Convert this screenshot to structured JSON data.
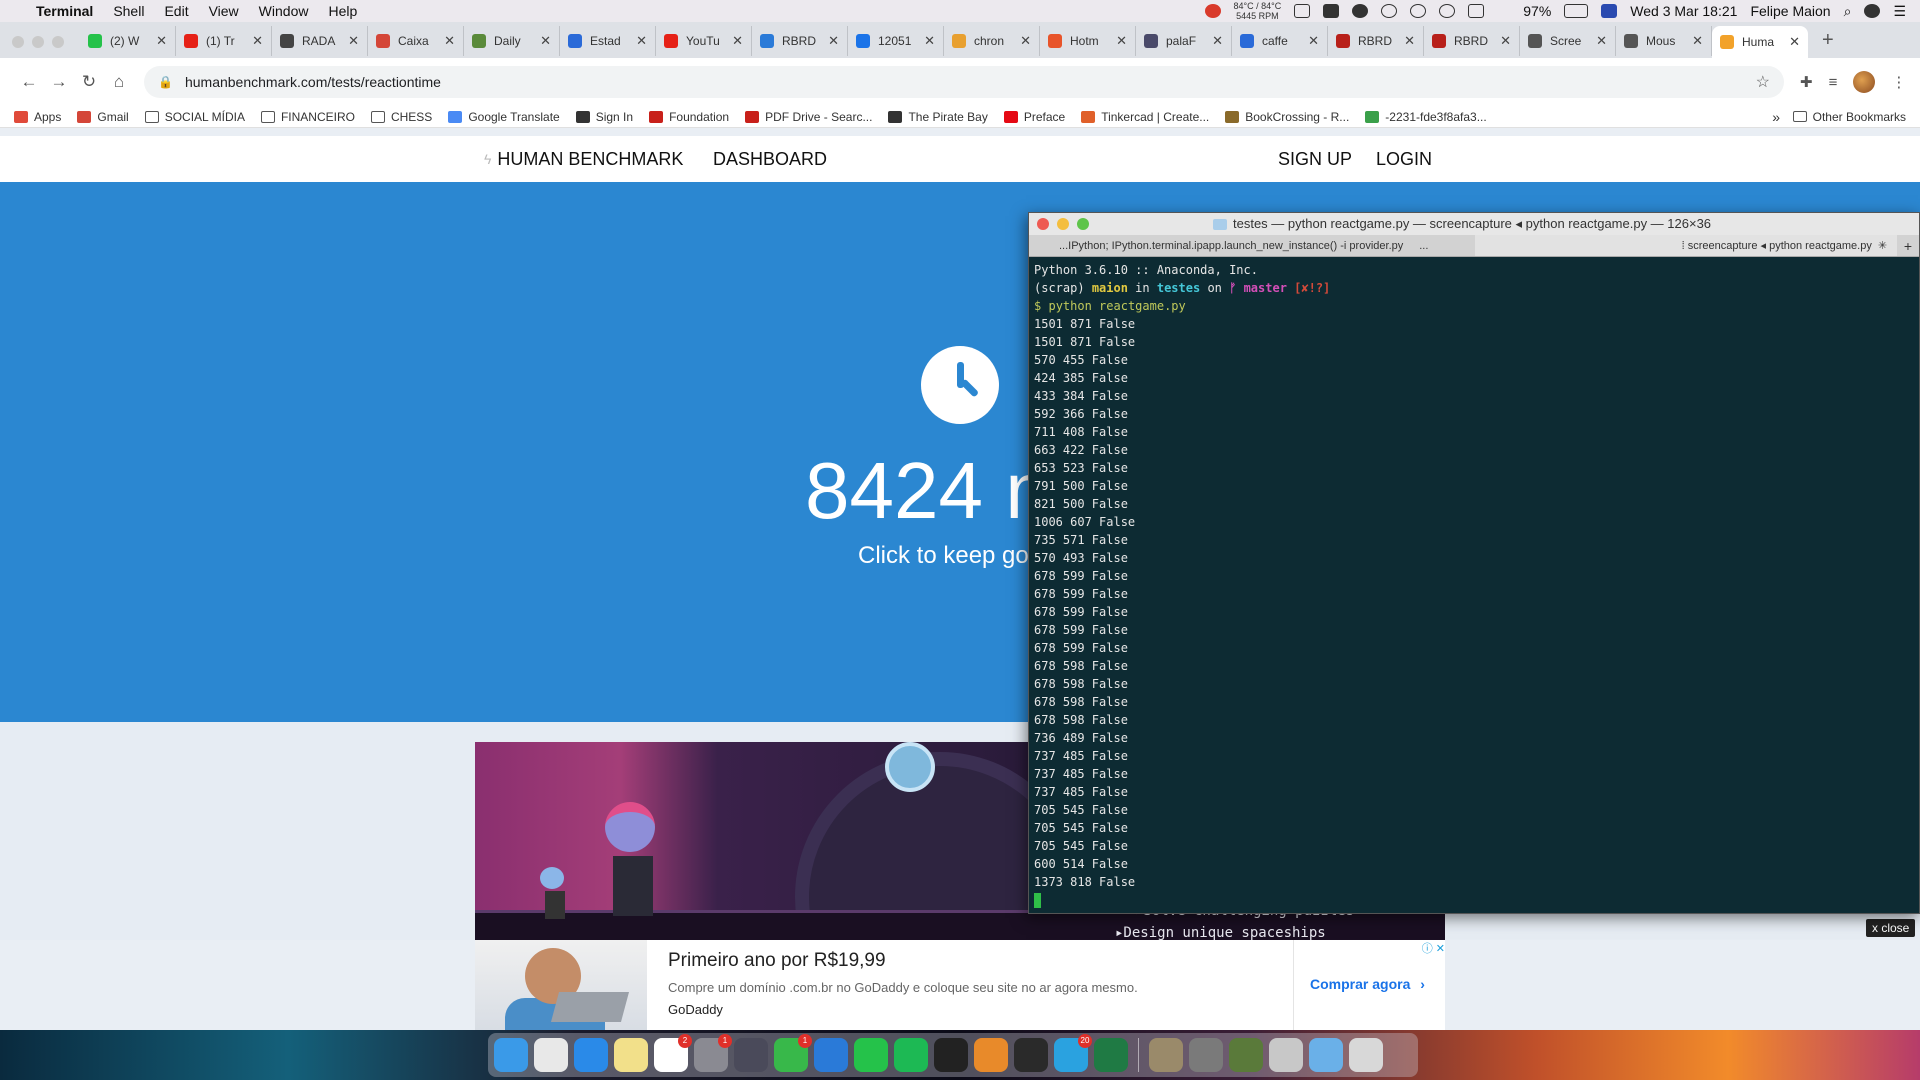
{
  "menubar": {
    "app_name": "Terminal",
    "menus": [
      "Shell",
      "Edit",
      "View",
      "Window",
      "Help"
    ],
    "temp_line1": "84°C / 84°C",
    "temp_line2": "5445 RPM",
    "battery": "97%",
    "datetime": "Wed 3 Mar  18:21",
    "user": "Felipe Maion"
  },
  "browser": {
    "tabs": [
      {
        "label": "(2) W",
        "color": "#25c24a"
      },
      {
        "label": "(1) Tr",
        "color": "#e62117"
      },
      {
        "label": "RADA",
        "color": "#444444"
      },
      {
        "label": "Caixa",
        "color": "#d44638"
      },
      {
        "label": "Daily",
        "color": "#5a8a3a"
      },
      {
        "label": "Estad",
        "color": "#2a6ad8"
      },
      {
        "label": "YouTu",
        "color": "#e62117"
      },
      {
        "label": "RBRD",
        "color": "#2a7ad8"
      },
      {
        "label": "12051",
        "color": "#1a73e8"
      },
      {
        "label": "chron",
        "color": "#e8a030"
      },
      {
        "label": "Hotm",
        "color": "#e8542a"
      },
      {
        "label": "palaF",
        "color": "#4a4a6a"
      },
      {
        "label": "caffe",
        "color": "#2a6ad8"
      },
      {
        "label": "RBRD",
        "color": "#b8201a"
      },
      {
        "label": "RBRD",
        "color": "#b8201a"
      },
      {
        "label": "Scree",
        "color": "#555555"
      },
      {
        "label": "Mous",
        "color": "#555555"
      },
      {
        "label": "Huma",
        "color": "#f2a22a"
      }
    ],
    "url": "humanbenchmark.com/tests/reactiontime",
    "bookmarks": [
      {
        "label": "Apps",
        "kind": "apps"
      },
      {
        "label": "Gmail",
        "kind": "gmail"
      },
      {
        "label": "SOCIAL MÍDIA",
        "kind": "folder"
      },
      {
        "label": "FINANCEIRO",
        "kind": "folder"
      },
      {
        "label": "CHESS",
        "kind": "folder"
      },
      {
        "label": "Google Translate",
        "kind": "translate"
      },
      {
        "label": "Sign In",
        "kind": "github"
      },
      {
        "label": "Foundation",
        "kind": "pg"
      },
      {
        "label": "PDF Drive - Searc...",
        "kind": "pdf"
      },
      {
        "label": "The Pirate Bay",
        "kind": "pirate"
      },
      {
        "label": "Preface",
        "kind": "netflix"
      },
      {
        "label": "Tinkercad | Create...",
        "kind": "tinkercad"
      },
      {
        "label": "BookCrossing - R...",
        "kind": "book"
      },
      {
        "label": "-2231-fde3f8afa3...",
        "kind": "drive"
      }
    ],
    "more_bookmarks": "»",
    "other_bookmarks": "Other Bookmarks"
  },
  "site": {
    "brand": "HUMAN BENCHMARK",
    "dashboard": "DASHBOARD",
    "signup": "SIGN UP",
    "login": "LOGIN",
    "score": "8424 ms",
    "subtitle": "Click to keep going"
  },
  "game_ad": {
    "features": [
      "▸Solve challenging puzzles",
      "▸Design unique spaceships"
    ]
  },
  "ad": {
    "headline": "Primeiro ano por R$19,99",
    "description": "Compre um domínio .com.br no GoDaddy e coloque seu site no ar agora mesmo.",
    "advertiser": "GoDaddy",
    "cta": "Comprar agora",
    "cta_arrow": "›",
    "close": "x close"
  },
  "terminal": {
    "title": "testes — python reactgame.py — screencapture ◂ python reactgame.py — 126×36",
    "tab1": "...IPython; IPython.terminal.ipapp.launch_new_instance() -i provider.py",
    "tab1_more": "...",
    "tab2": "⁞ screencapture ◂ python reactgame.py",
    "header_line": "Python 3.6.10 :: Anaconda, Inc.",
    "prompt": {
      "env": "(scrap)",
      "user": "maion",
      "in": "in",
      "dir": "testes",
      "on": "on",
      "branch": "ᚠ master",
      "status": "[✘!?]",
      "symbol": "$",
      "command": "python reactgame.py"
    },
    "output": [
      "1501 871 False",
      "1501 871 False",
      "570 455 False",
      "424 385 False",
      "433 384 False",
      "592 366 False",
      "711 408 False",
      "663 422 False",
      "653 523 False",
      "791 500 False",
      "821 500 False",
      "1006 607 False",
      "735 571 False",
      "570 493 False",
      "678 599 False",
      "678 599 False",
      "678 599 False",
      "678 599 False",
      "678 599 False",
      "678 598 False",
      "678 598 False",
      "678 598 False",
      "678 598 False",
      "736 489 False",
      "737 485 False",
      "737 485 False",
      "737 485 False",
      "705 545 False",
      "705 545 False",
      "705 545 False",
      "600 514 False",
      "1373 818 False"
    ]
  },
  "dock": {
    "apps": [
      {
        "name": "finder-icon",
        "color": "#3a9ae8"
      },
      {
        "name": "chrome-icon",
        "color": "#e8e8e8"
      },
      {
        "name": "safari-icon",
        "color": "#2a8ae8"
      },
      {
        "name": "notes-icon",
        "color": "#f2e08a"
      },
      {
        "name": "calendar-icon",
        "color": "#ffffff",
        "badge": "2"
      },
      {
        "name": "system-preferences-icon",
        "color": "#8a8a92",
        "badge": "1"
      },
      {
        "name": "screenshot-icon",
        "color": "#4a4a5a"
      },
      {
        "name": "facetime-icon",
        "color": "#38b84a",
        "badge": "1"
      },
      {
        "name": "vscode-icon",
        "color": "#2a7ad8"
      },
      {
        "name": "whatsapp-icon",
        "color": "#25c24a"
      },
      {
        "name": "spotify-icon",
        "color": "#1db954"
      },
      {
        "name": "terminal-icon",
        "color": "#222222"
      },
      {
        "name": "books-icon",
        "color": "#e88a2a"
      },
      {
        "name": "activity-monitor-icon",
        "color": "#2a2a2a"
      },
      {
        "name": "telegram-icon",
        "color": "#2aa2e0",
        "badge": "20"
      },
      {
        "name": "excel-icon",
        "color": "#1f7a44"
      }
    ],
    "apps_right": [
      {
        "name": "vlc-icon",
        "color": "#9a8a6a"
      },
      {
        "name": "disk-utility-icon",
        "color": "#7a7a7a"
      },
      {
        "name": "image-app-icon",
        "color": "#5a7a3a"
      },
      {
        "name": "printer-icon",
        "color": "#c8c8c8"
      },
      {
        "name": "downloads-folder-icon",
        "color": "#6ab0e8"
      },
      {
        "name": "trash-icon",
        "color": "#d8d8d8"
      }
    ]
  }
}
